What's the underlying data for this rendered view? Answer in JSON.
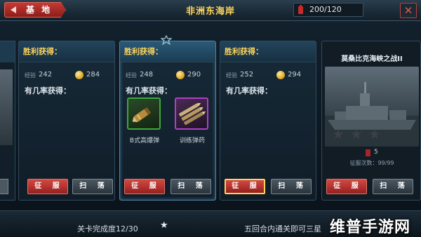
{
  "header": {
    "back_label": "基 地",
    "title": "非洲东海岸",
    "energy": "200/120",
    "close_label": "✕"
  },
  "panels": [
    {
      "victory_label": "胜利获得：",
      "exp_label": "经验",
      "exp": "242",
      "gold": "284",
      "chance_label": "有几率获得：",
      "items": [],
      "conquer_label": "征 服",
      "sweep_label": "扫 荡"
    },
    {
      "victory_label": "胜利获得：",
      "exp_label": "经验",
      "exp": "248",
      "gold": "290",
      "chance_label": "有几率获得：",
      "items": [
        {
          "name": "B式高爆弹",
          "frame": "green",
          "icon": "shell-icon"
        },
        {
          "name": "训练弹药",
          "frame": "purple",
          "icon": "ammo-icon"
        }
      ],
      "conquer_label": "征 服",
      "sweep_label": "扫 荡"
    },
    {
      "victory_label": "胜利获得：",
      "exp_label": "经验",
      "exp": "252",
      "gold": "294",
      "chance_label": "有几率获得：",
      "items": [],
      "conquer_label": "征 服",
      "sweep_label": "扫 荡"
    }
  ],
  "ship_panel": {
    "title": "莫桑比克海峡之战II",
    "energy": "5",
    "count": "征服次数：99/99",
    "stars_filled": 0,
    "stars_total": 3,
    "conquer_label": "征 服",
    "sweep_label": "扫 荡"
  },
  "footer": {
    "progress": "关卡完成度12/30",
    "hint": "五回合内通关即可三星",
    "watermark": "维普手游网"
  },
  "colors": {
    "title_gold": "#ffd45a",
    "button_red": "#b8322d",
    "item_green": "#3ea83a",
    "item_purple": "#b23fc6"
  }
}
